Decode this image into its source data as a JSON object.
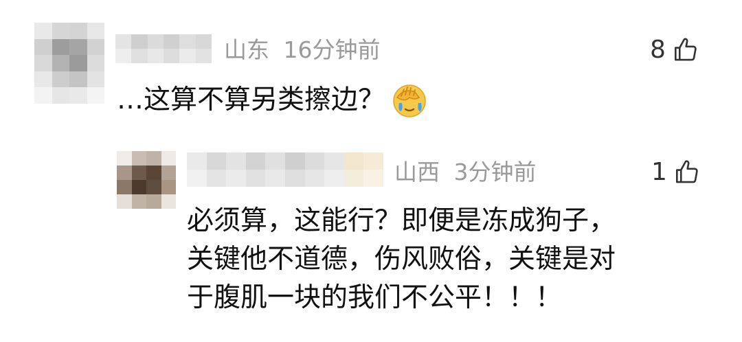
{
  "comments": [
    {
      "location": "山东",
      "time": "16分钟前",
      "likes": "8",
      "text": "…这算不算另类擦边？",
      "emoji": "facepalm-crying-emoji",
      "reply": {
        "location": "山西",
        "time": "3分钟前",
        "likes": "1",
        "lines": [
          "必须算，这能行？即便是冻成狗子，",
          "关键他不道德，伤风败俗，关键是对",
          "于腹肌一块的我们不公平！！！"
        ]
      }
    }
  ],
  "icons": {
    "like": "thumbs-up-icon"
  }
}
